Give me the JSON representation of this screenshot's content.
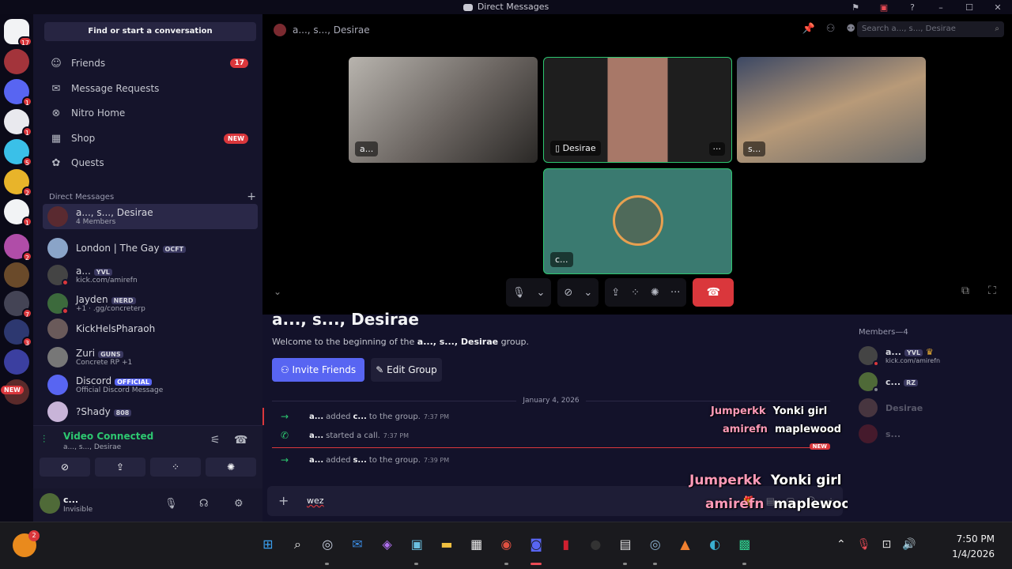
{
  "window": {
    "title": "Direct Messages"
  },
  "rail": {
    "servers": [
      {
        "badge": "17"
      },
      {
        "badge": ""
      },
      {
        "badge": "1"
      },
      {
        "badge": "1"
      },
      {
        "badge": "5"
      },
      {
        "badge": "2"
      },
      {
        "badge": "1"
      },
      {
        "badge": "2"
      },
      {
        "badge": ""
      },
      {
        "badge": "7"
      },
      {
        "badge": "3"
      },
      {
        "badge": ""
      },
      {
        "badge": "NEW"
      }
    ]
  },
  "sidebar": {
    "search_label": "Find or start a conversation",
    "nav": [
      {
        "label": "Friends",
        "icon": "friends-icon",
        "badge": "17"
      },
      {
        "label": "Message Requests",
        "icon": "mail-icon",
        "badge": ""
      },
      {
        "label": "Nitro Home",
        "icon": "nitro-icon",
        "badge": ""
      },
      {
        "label": "Shop",
        "icon": "shop-icon",
        "badge": "NEW"
      },
      {
        "label": "Quests",
        "icon": "quests-icon",
        "badge": ""
      }
    ],
    "dm_header": "Direct Messages",
    "dms": [
      {
        "name": "a..., s..., Desirae",
        "sub": "4 Members",
        "tag": ""
      },
      {
        "name": "London | The Gay",
        "sub": "",
        "tag": "OCFT"
      },
      {
        "name": "a...",
        "sub": "kick.com/amirefn",
        "tag": "YVL"
      },
      {
        "name": "Jayden",
        "sub": "+1 · .gg/concreterp",
        "tag": "NERD"
      },
      {
        "name": "KickHelsPharaoh",
        "sub": "",
        "tag": ""
      },
      {
        "name": "Zuri",
        "sub": "Concrete RP +1",
        "tag": "GUNS"
      },
      {
        "name": "Discord",
        "sub": "Official Discord Message",
        "tag": "OFFICIAL"
      },
      {
        "name": "?Shady",
        "sub": "",
        "tag": "808"
      }
    ],
    "voice": {
      "title": "Video Connected",
      "sub": "a..., s..., Desirae"
    },
    "user": {
      "name": "c...",
      "status": "Invisible"
    }
  },
  "call": {
    "channel_title": "a..., s..., Desirae",
    "search_placeholder": "Search a..., s..., Desirae",
    "tiles": [
      {
        "label": "a..."
      },
      {
        "label": "Desirae",
        "more": "···"
      },
      {
        "label": "s..."
      },
      {
        "label": "c..."
      }
    ]
  },
  "chat": {
    "heading": "a..., s..., Desirae",
    "welcome_pre": "Welcome to the beginning of the ",
    "welcome_group": "a..., s..., Desirae",
    "welcome_post": " group.",
    "invite_label": "Invite Friends",
    "edit_label": "Edit Group",
    "date_divider": "January 4, 2026",
    "events": [
      {
        "actor": "a...",
        "text1": "added",
        "target": "c...",
        "text2": "to the group.",
        "time": "7:37 PM"
      },
      {
        "actor": "a...",
        "text1": "started a call.",
        "target": "",
        "text2": "",
        "time": "7:37 PM"
      },
      {
        "actor": "a...",
        "text1": "added",
        "target": "s...",
        "text2": "to the group.",
        "time": "7:39 PM"
      }
    ],
    "new_label": "NEW",
    "input_value": "wez",
    "overlay_small": {
      "a": "Jumperkk",
      "b": "Yonki girl",
      "c": "amirefn",
      "d": "maplewood"
    },
    "overlay_large": {
      "a": "Jumperkk",
      "b": "Yonki girl",
      "c": "amirefn",
      "d": "maplewood"
    }
  },
  "members": {
    "header": "Members—4",
    "list": [
      {
        "name": "a...",
        "tag": "YVL",
        "sub": "kick.com/amirefn"
      },
      {
        "name": "c...",
        "tag": "RZ",
        "sub": ""
      },
      {
        "name": "Desirae",
        "tag": "",
        "sub": ""
      },
      {
        "name": "s...",
        "tag": "",
        "sub": ""
      }
    ]
  },
  "taskbar": {
    "time": "7:50 PM",
    "date": "1/4/2026",
    "notify_badge": "2"
  },
  "colors": {
    "accent": "#5865f2",
    "danger": "#da373c",
    "online": "#2dc770"
  }
}
